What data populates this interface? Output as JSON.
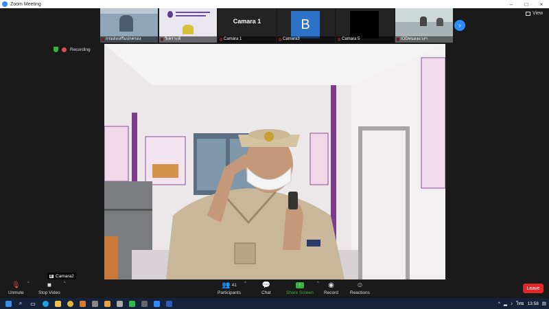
{
  "window": {
    "title": "Zoom Meeting"
  },
  "thumbnails": [
    {
      "name": "กรมส่งเสริมปกครอง",
      "kind": "video",
      "bg": "#8fa6b8"
    },
    {
      "name": "วิเคราะห์",
      "kind": "slide",
      "bg": "#e9e6ef"
    },
    {
      "name": "Camara 1",
      "kind": "text",
      "bg": "#232323",
      "label": "Camara 1"
    },
    {
      "name": "Camara3",
      "kind": "avatar",
      "bg": "#232323",
      "label": "B"
    },
    {
      "name": "Camara 5",
      "kind": "black",
      "bg": "#232323"
    },
    {
      "name": "IODหนองแวงฯ",
      "kind": "video",
      "bg": "#cfd8d8"
    }
  ],
  "view_label": "View",
  "recording_label": "Recording",
  "speaker": {
    "name": "Camara2"
  },
  "toolbar": {
    "unmute": "Unmute",
    "stop_video": "Stop Video",
    "participants": "Participants",
    "participants_count": "41",
    "chat": "Chat",
    "share_screen": "Share Screen",
    "record": "Record",
    "reactions": "Reactions",
    "leave": "Leave"
  },
  "taskbar": {
    "lang": "ไทย",
    "time": "13:58"
  },
  "colors": {
    "accent": "#2d8cff",
    "leave": "#e02828",
    "share": "#3cb043",
    "taskbar": "#14223a"
  }
}
